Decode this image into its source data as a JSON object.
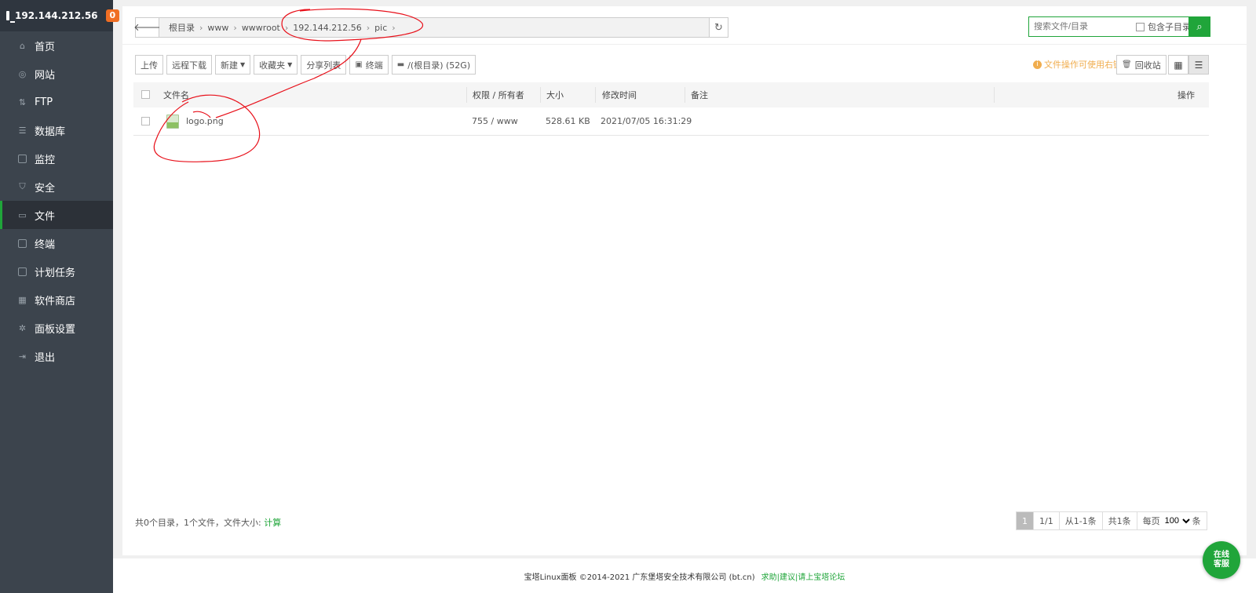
{
  "sidebar": {
    "host": "192.144.212.56",
    "badge": "0",
    "items": [
      {
        "label": "首页",
        "icon": "home-icon"
      },
      {
        "label": "网站",
        "icon": "globe-icon"
      },
      {
        "label": "FTP",
        "icon": "ftp-icon"
      },
      {
        "label": "数据库",
        "icon": "database-icon"
      },
      {
        "label": "监控",
        "icon": "monitor-icon"
      },
      {
        "label": "安全",
        "icon": "shield-icon"
      },
      {
        "label": "文件",
        "icon": "folder-icon",
        "active": true
      },
      {
        "label": "终端",
        "icon": "terminal-icon"
      },
      {
        "label": "计划任务",
        "icon": "calendar-icon"
      },
      {
        "label": "软件商店",
        "icon": "apps-icon"
      },
      {
        "label": "面板设置",
        "icon": "gear-icon"
      },
      {
        "label": "退出",
        "icon": "logout-icon"
      }
    ]
  },
  "breadcrumb": [
    "根目录",
    "www",
    "wwwroot",
    "192.144.212.56",
    "pic"
  ],
  "search": {
    "placeholder": "搜索文件/目录",
    "include_subdir": "包含子目录"
  },
  "toolbar": {
    "upload": "上传",
    "remote_download": "远程下载",
    "new": "新建",
    "favorites": "收藏夹",
    "share_list": "分享列表",
    "terminal": "终端",
    "disk": "/(根目录) (52G)"
  },
  "hint": "文件操作可使用右键",
  "recycle": "回收站",
  "table": {
    "headers": {
      "name": "文件名",
      "perm": "权限 / 所有者",
      "size": "大小",
      "mtime": "修改时间",
      "note": "备注",
      "ops": "操作"
    },
    "rows": [
      {
        "name": "logo.png",
        "perm": "755 / www",
        "size": "528.61 KB",
        "mtime": "2021/07/05 16:31:29",
        "note": ""
      }
    ]
  },
  "summary": {
    "text": "共0个目录，1个文件，文件大小:",
    "calc": "计算"
  },
  "pager": {
    "current": "1",
    "pages": "1/1",
    "range": "从1-1条",
    "total": "共1条",
    "per_page_label": "每页",
    "per_page": "100",
    "unit": "条"
  },
  "copyright": {
    "text": "宝塔Linux面板 ©2014-2021 广东堡塔安全技术有限公司 (bt.cn)",
    "link": "求助|建议|请上宝塔论坛"
  },
  "online_service": "在线客服",
  "colors": {
    "accent": "#20a53a",
    "sidebar": "#3c444d",
    "warning": "#f0ad4e",
    "annotation": "#e8101a"
  }
}
